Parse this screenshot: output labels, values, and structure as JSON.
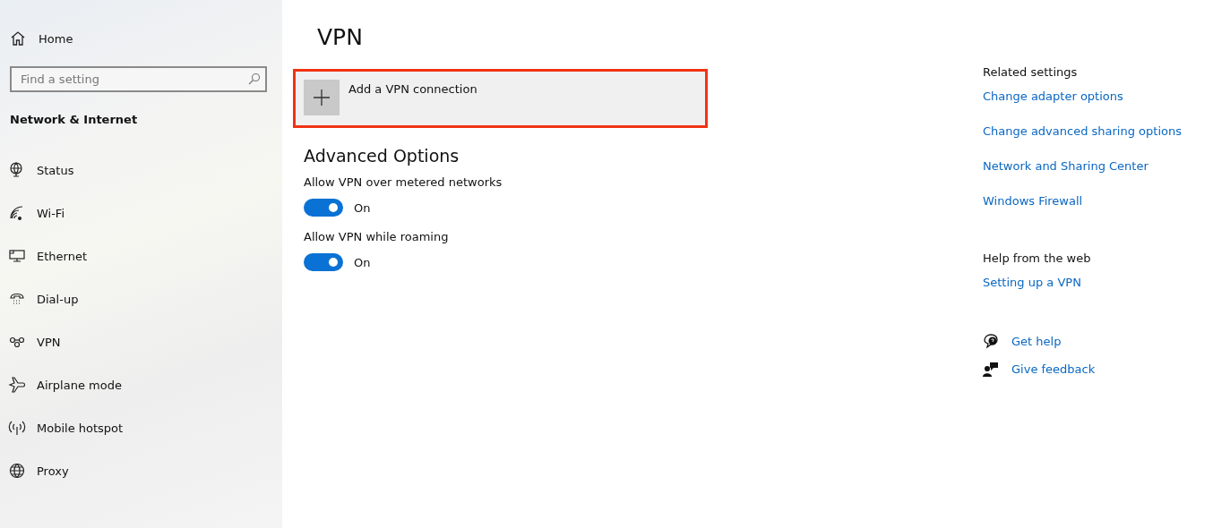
{
  "sidebar": {
    "home": {
      "label": "Home"
    },
    "search": {
      "placeholder": "Find a setting"
    },
    "section": "Network & Internet",
    "items": [
      {
        "label": "Status",
        "kind": "status"
      },
      {
        "label": "Wi-Fi",
        "kind": "wifi"
      },
      {
        "label": "Ethernet",
        "kind": "ethernet"
      },
      {
        "label": "Dial-up",
        "kind": "dialup"
      },
      {
        "label": "VPN",
        "kind": "vpn"
      },
      {
        "label": "Airplane mode",
        "kind": "airplane"
      },
      {
        "label": "Mobile hotspot",
        "kind": "hotspot"
      },
      {
        "label": "Proxy",
        "kind": "proxy"
      }
    ]
  },
  "main": {
    "title": "VPN",
    "add_connection": {
      "label": "Add a VPN connection",
      "highlighted": true
    },
    "advanced": {
      "heading": "Advanced Options",
      "options": [
        {
          "label": "Allow VPN over metered networks",
          "on": true,
          "state_label": "On"
        },
        {
          "label": "Allow VPN while roaming",
          "on": true,
          "state_label": "On"
        }
      ]
    }
  },
  "related": {
    "heading": "Related settings",
    "links": [
      "Change adapter options",
      "Change advanced sharing options",
      "Network and Sharing Center",
      "Windows Firewall"
    ]
  },
  "help": {
    "heading": "Help from the web",
    "links": [
      "Setting up a VPN"
    ]
  },
  "support": [
    {
      "label": "Get help",
      "kind": "help"
    },
    {
      "label": "Give feedback",
      "kind": "feedback"
    }
  ]
}
